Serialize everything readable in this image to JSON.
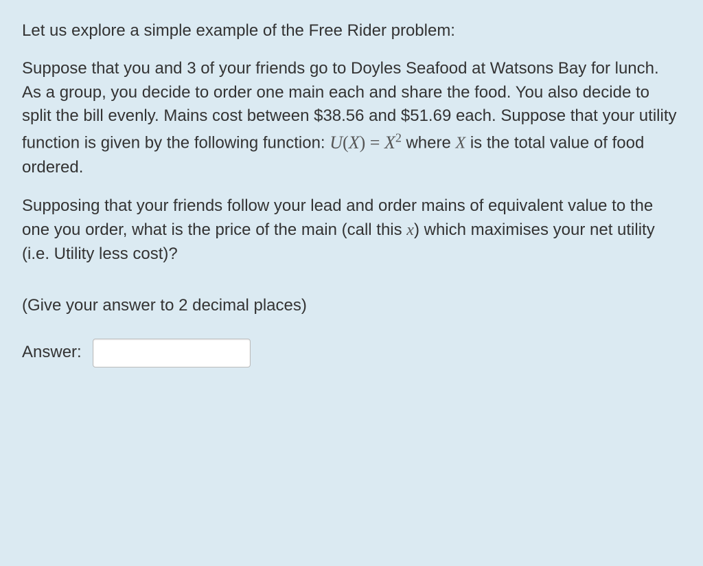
{
  "intro": "Let us explore a simple example of the Free Rider problem:",
  "setup_part1": "Suppose that you and 3 of your friends go to Doyles Seafood at Watsons Bay for lunch. As a group, you decide to order one main each and share the food. You also decide to split the bill evenly. Mains cost between $38.56 and $51.69 each. Suppose that your utility function is given by the following function: ",
  "formula_lhs": "U",
  "formula_arg": "X",
  "formula_rhs_base": "X",
  "formula_rhs_exp": "2",
  "setup_part2_prefix": " where ",
  "setup_part2_var": "X",
  "setup_part2_suffix": " is the total value of food ordered.",
  "question_part1": "Supposing that your friends follow your lead and order mains of equivalent value to the one you order, what is the price of the main (call this ",
  "question_var": "x",
  "question_part2": ") which maximises your net utility (i.e. Utility less cost)?",
  "instruction": "(Give your answer to 2 decimal places)",
  "answer_label": "Answer:",
  "answer_value": ""
}
